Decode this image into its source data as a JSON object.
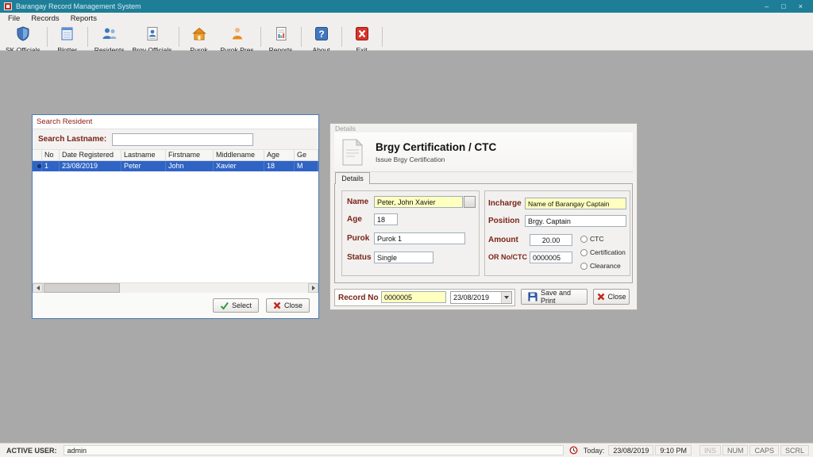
{
  "colors": {
    "titlebar": "#1E7E98",
    "selection_blue": "#2F64C5",
    "field_yellow": "#FFFFC0",
    "label_maroon": "#7A2418",
    "client_gray": "#A9A9A9"
  },
  "window": {
    "title": "Barangay Record Management System",
    "minimize_glyph": "–",
    "maximize_glyph": "□",
    "close_glyph": "×"
  },
  "menu": {
    "items": [
      {
        "label": "File"
      },
      {
        "label": "Records"
      },
      {
        "label": "Reports"
      }
    ]
  },
  "toolbar": {
    "items": [
      {
        "label": "SK Officials"
      },
      {
        "label": "Blotter"
      },
      {
        "label": "Residents"
      },
      {
        "label": "Brgy Officials"
      },
      {
        "label": "Purok"
      },
      {
        "label": "Purok Pres"
      },
      {
        "label": "Reports"
      },
      {
        "label": "About"
      },
      {
        "label": "Exit"
      }
    ]
  },
  "search_window": {
    "title": "Search Resident",
    "search_label": "Search Lastname:",
    "search_value": "",
    "grid": {
      "columns": [
        "No",
        "Date Registered",
        "Lastname",
        "Firstname",
        "Middlename",
        "Age",
        "Ge"
      ],
      "rows": [
        {
          "no": "1",
          "date": "23/08/2019",
          "lastname": "Peter",
          "firstname": "John",
          "middlename": "Xavier",
          "age": "18",
          "gender": "M"
        }
      ]
    },
    "select_button": "Select",
    "close_button": "Close"
  },
  "details": {
    "caption": "Details",
    "title": "Brgy Certification / CTC",
    "subtitle": "Issue Brgy Certification",
    "tab_label": "Details",
    "fields": {
      "name_label": "Name",
      "name_value": "Peter, John Xavier",
      "age_label": "Age",
      "age_value": "18",
      "purok_label": "Purok",
      "purok_value": "Purok 1",
      "status_label": "Status",
      "status_value": "Single",
      "incharge_label": "Incharge",
      "incharge_value": "Name of Barangay Captain",
      "position_label": "Position",
      "position_value": "Brgy. Captain",
      "amount_label": "Amount",
      "amount_value": "20.00",
      "orno_label": "OR No/CTC",
      "orno_value": "0000005"
    },
    "radios": [
      {
        "label": "CTC"
      },
      {
        "label": "Certification"
      },
      {
        "label": "Clearance"
      }
    ],
    "record_no_label": "Record No",
    "record_no_value": "0000005",
    "record_date_value": "23/08/2019",
    "save_button": "Save and Print",
    "close_button": "Close"
  },
  "statusbar": {
    "active_user_label": "ACTIVE USER:",
    "active_user_value": "admin",
    "today_label": "Today:",
    "date": "23/08/2019",
    "time": "9:10 PM",
    "indicators": [
      {
        "label": "INS"
      },
      {
        "label": "NUM"
      },
      {
        "label": "CAPS"
      },
      {
        "label": "SCRL"
      }
    ]
  }
}
